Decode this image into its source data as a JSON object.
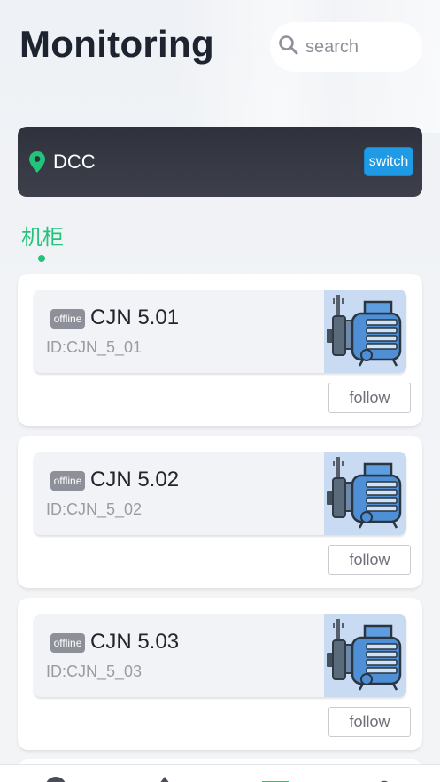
{
  "header": {
    "title": "Monitoring",
    "search_placeholder": "search"
  },
  "location": {
    "name": "DCC",
    "switch_label": "switch",
    "pin_color": "#22c37a"
  },
  "tabs": [
    {
      "label": "机柜",
      "active": true
    }
  ],
  "devices": [
    {
      "status": "offline",
      "name": "CJN 5.01",
      "id": "ID:CJN_5_01",
      "follow_label": "follow"
    },
    {
      "status": "offline",
      "name": "CJN 5.02",
      "id": "ID:CJN_5_02",
      "follow_label": "follow"
    },
    {
      "status": "offline",
      "name": "CJN 5.03",
      "id": "ID:CJN_5_03",
      "follow_label": "follow"
    }
  ],
  "bottom_nav": [
    {
      "icon": "globe-icon"
    },
    {
      "icon": "device-icon"
    },
    {
      "icon": "monitor-icon",
      "active": true
    },
    {
      "icon": "user-icon"
    }
  ],
  "colors": {
    "accent_green": "#22c37a",
    "switch_blue": "#1f9be6",
    "offline_badge": "#8e9099"
  }
}
